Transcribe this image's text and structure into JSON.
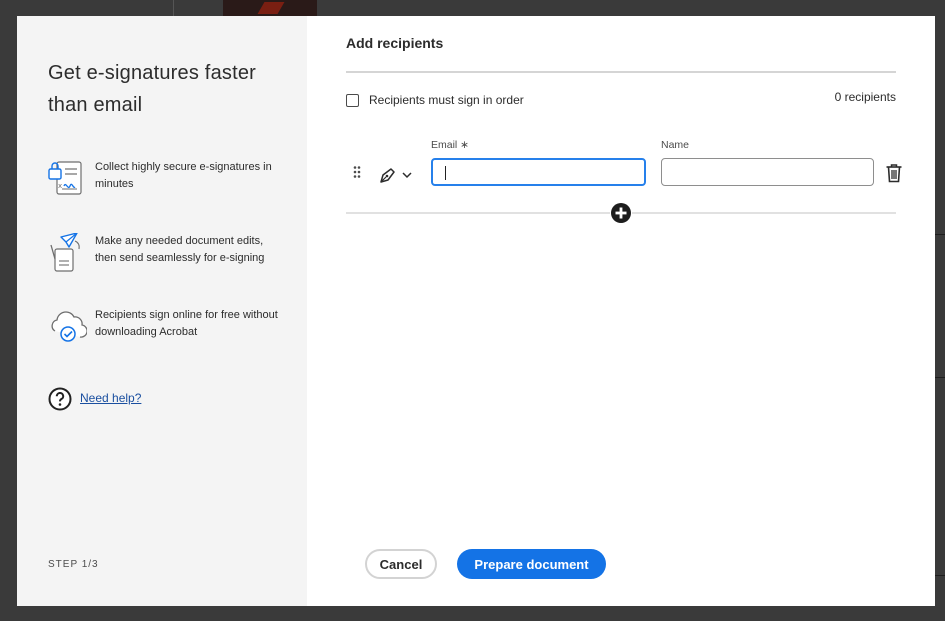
{
  "sidebar": {
    "title": "Get e-signatures faster than email",
    "features": [
      {
        "icon": "secure-document-icon",
        "text": "Collect highly secure e-signatures in minutes"
      },
      {
        "icon": "send-document-icon",
        "text": "Make any needed document edits, then send seamlessly for e-signing"
      },
      {
        "icon": "cloud-check-icon",
        "text": "Recipients sign online for free without downloading Acrobat"
      }
    ],
    "help": {
      "icon": "question-circle-icon",
      "label": "Need help?"
    }
  },
  "main": {
    "title": "Add recipients",
    "sign_in_order": {
      "label": "Recipients must sign in order",
      "checked": false
    },
    "recipient_count": "0 recipients",
    "recipient": {
      "email_label": "Email ∗",
      "email_value": "",
      "name_label": "Name",
      "name_value": "",
      "role_icon": "pen-icon"
    }
  },
  "footer": {
    "step": "STEP 1/3",
    "cancel_label": "Cancel",
    "primary_label": "Prepare document"
  },
  "colors": {
    "accent": "#1473e6",
    "focus_border": "#2680eb",
    "sidebar_bg": "#f4f4f4",
    "link": "#1a4fa0"
  }
}
